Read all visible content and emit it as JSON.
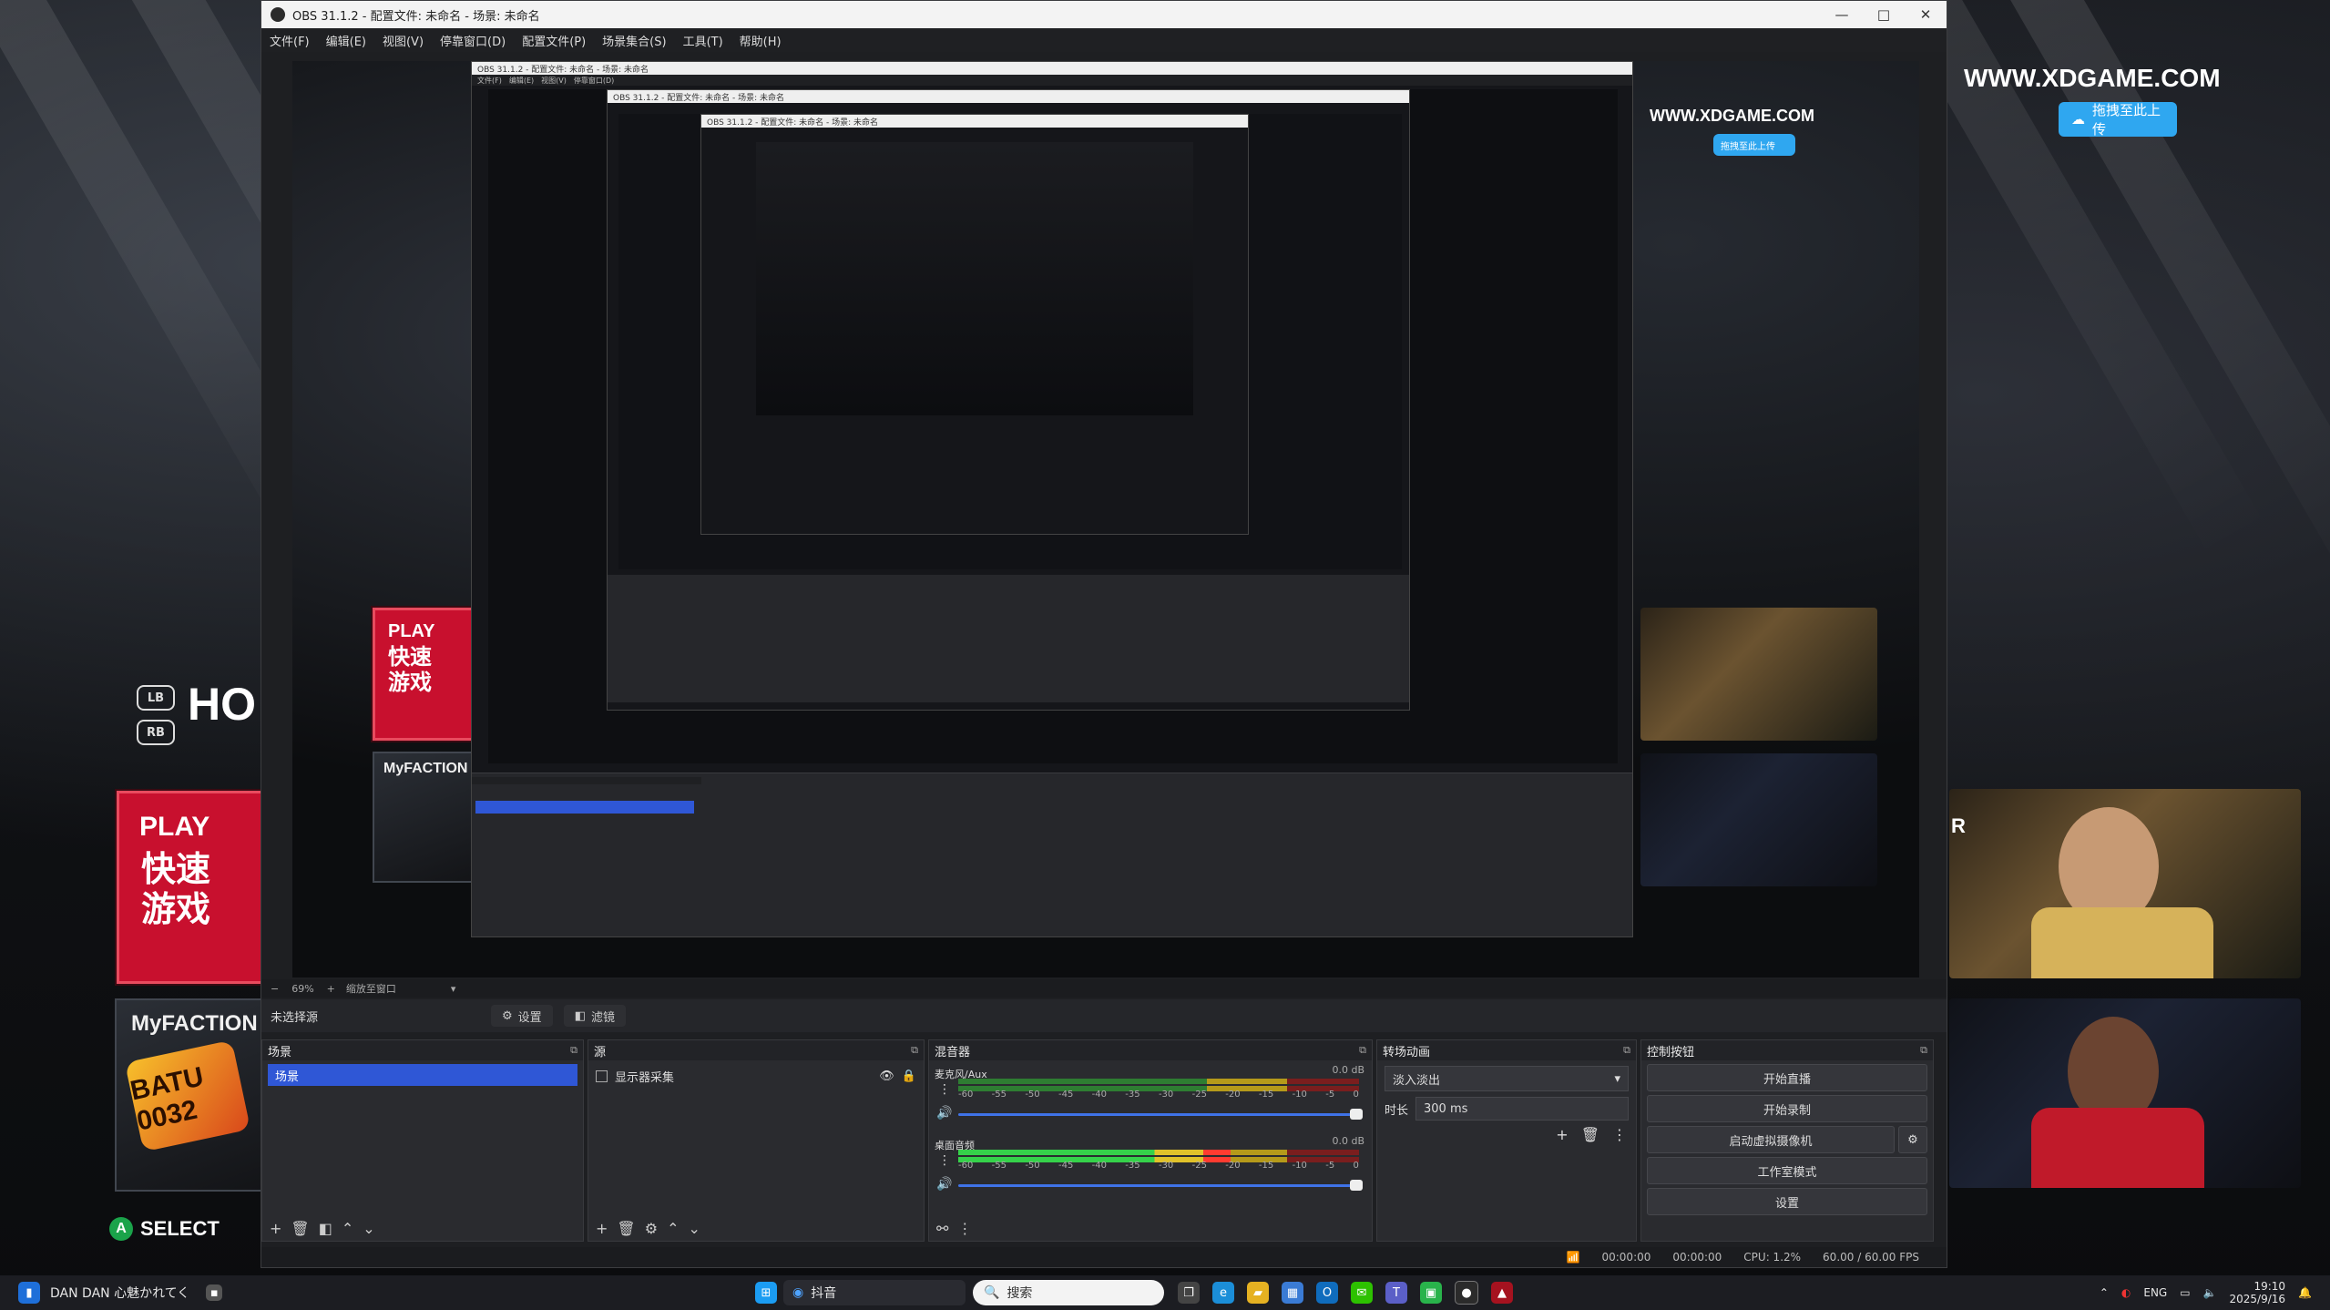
{
  "desktop": {
    "brand_url": "WWW.XDGAME.COM",
    "upload_label": "拖拽至此上传",
    "play_label": "PLAY",
    "fast_game_label": "快速游戏",
    "faction_label": "MyFACTION",
    "faction_badge": "BATU 0032",
    "select_label": "SELECT",
    "ho_label": "HO",
    "lb_label": "LB",
    "rb_label": "RB",
    "r_label": "R"
  },
  "obs": {
    "title": "OBS 31.1.2 - 配置文件: 未命名 - 场景: 未命名",
    "menu": [
      "文件(F)",
      "编辑(E)",
      "视图(V)",
      "停靠窗口(D)",
      "配置文件(P)",
      "场景集合(S)",
      "工具(T)",
      "帮助(H)"
    ],
    "zoom": "69%",
    "zoom_label": "缩放至窗口",
    "no_source": "未选择源",
    "properties_btn": "设置",
    "filters_btn": "滤镜",
    "docks": {
      "scenes_title": "场景",
      "scenes": [
        "场景"
      ],
      "sources_title": "源",
      "sources": [
        "显示器采集"
      ],
      "mixer_title": "混音器",
      "mixer_channels": [
        {
          "name": "麦克风/Aux",
          "db": "0.0 dB",
          "level": 0.0
        },
        {
          "name": "桌面音频",
          "db": "0.0 dB",
          "level": 0.68
        }
      ],
      "mixer_ticks": [
        "-60",
        "-55",
        "-50",
        "-45",
        "-40",
        "-35",
        "-30",
        "-25",
        "-20",
        "-15",
        "-10",
        "-5",
        "0"
      ],
      "transitions_title": "转场动画",
      "transition": "淡入淡出",
      "duration_label": "时长",
      "duration": "300 ms",
      "controls_title": "控制按钮",
      "controls": [
        "开始直播",
        "开始录制",
        "启动虚拟摄像机",
        "工作室模式",
        "设置"
      ]
    },
    "status": {
      "rec_time": "00:00:00",
      "stream_time": "00:00:00",
      "cpu": "CPU: 1.2%",
      "fps": "60.00 / 60.00 FPS"
    }
  },
  "taskbar": {
    "app_label": "DAN DAN 心魅かれてく",
    "douyin_label": "抖音",
    "search_placeholder": "搜索",
    "lang": "ENG",
    "time": "19:10",
    "date": "2025/9/16"
  },
  "colors": {
    "accent_blue": "#2f57d6",
    "play_red": "#c8102e",
    "upload_blue": "#2fa7f0"
  }
}
